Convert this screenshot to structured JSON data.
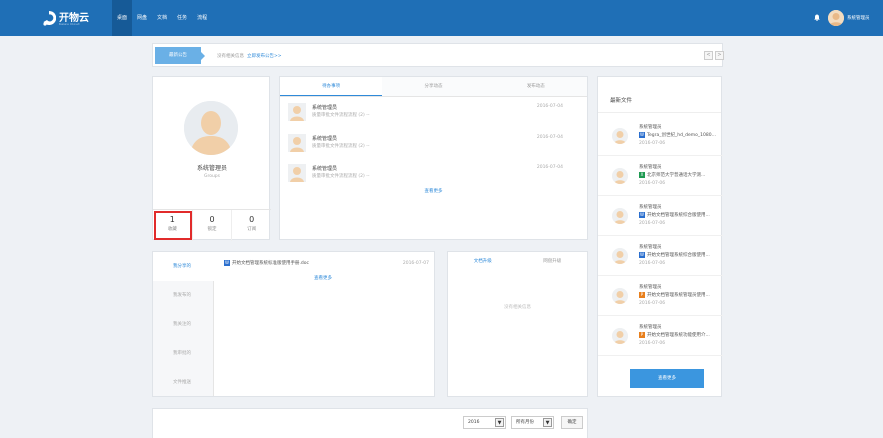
{
  "header": {
    "logo_text": "开物云",
    "logo_sub": "Kaiwu Cloud",
    "nav": [
      "桌面",
      "网盘",
      "文档",
      "任务",
      "流程"
    ],
    "user_name": "系统管理员"
  },
  "notice": {
    "label": "最新公告",
    "text": "没有相关信息",
    "link": "立即发布公告>>",
    "prev": "<",
    "next": ">"
  },
  "profile": {
    "name": "系统管理员",
    "group": "Groups",
    "stats": [
      {
        "value": "1",
        "label": "收藏"
      },
      {
        "value": "0",
        "label": "锁定"
      },
      {
        "value": "0",
        "label": "订阅"
      }
    ]
  },
  "todo": {
    "tabs": [
      "待办事项",
      "分享动态",
      "发布动态"
    ],
    "items": [
      {
        "user": "系统管理员",
        "text": "质量审批文件流程流程 (2) --",
        "date": "2016-07-04"
      },
      {
        "user": "系统管理员",
        "text": "质量审批文件流程流程 (2) --",
        "date": "2016-07-04"
      },
      {
        "user": "系统管理员",
        "text": "质量审批文件流程流程 (2) --",
        "date": "2016-07-04"
      }
    ],
    "more": "查看更多"
  },
  "recent": {
    "title": "最新文件",
    "items": [
      {
        "user": "系统管理员",
        "file": "Tegra_创世纪_hd_demo_1080...",
        "type": "word",
        "date": "2016-07-06"
      },
      {
        "user": "系统管理员",
        "file": "北京师范大学普通话大学测...",
        "type": "excel",
        "date": "2016-07-06"
      },
      {
        "user": "系统管理员",
        "file": "开始文档管理系统综合版使用...",
        "type": "word",
        "date": "2016-07-06"
      },
      {
        "user": "系统管理员",
        "file": "开始文档管理系统综合版使用...",
        "type": "word",
        "date": "2016-07-06"
      },
      {
        "user": "系统管理员",
        "file": "开始文档管理系统管理员使用...",
        "type": "ppt",
        "date": "2016-07-06"
      },
      {
        "user": "系统管理员",
        "file": "开始文档管理系统功能使用介...",
        "type": "ppt",
        "date": "2016-07-06"
      }
    ],
    "more": "查看更多"
  },
  "mydocs": {
    "side": [
      "我分享的",
      "我发布的",
      "我关注的",
      "我审批的",
      "文件推送"
    ],
    "doc": {
      "name": "开始文档管理系统标准版使用手册.doc",
      "date": "2016-07-07"
    },
    "more": "查看更多"
  },
  "upgrade": {
    "tabs": [
      "文档升级",
      "网盘升级"
    ],
    "empty": "没有相关信息"
  },
  "filter": {
    "year": "2016",
    "month": "所有月份",
    "ok": "确定"
  }
}
